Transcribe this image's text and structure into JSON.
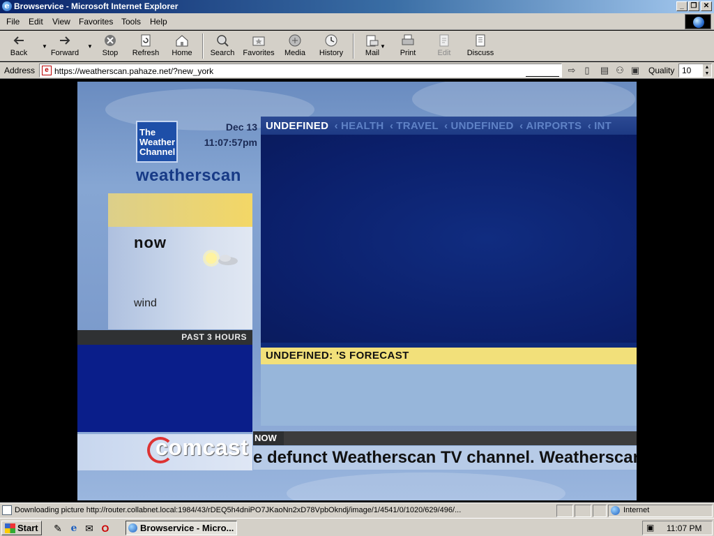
{
  "window": {
    "title": "Browservice - Microsoft Internet Explorer",
    "buttons": {
      "minimize": "_",
      "restore": "❐",
      "close": "✕"
    }
  },
  "menu": [
    "File",
    "Edit",
    "View",
    "Favorites",
    "Tools",
    "Help"
  ],
  "toolbar": {
    "back": "Back",
    "forward": "Forward",
    "stop": "Stop",
    "refresh": "Refresh",
    "home": "Home",
    "search": "Search",
    "favorites": "Favorites",
    "media": "Media",
    "history": "History",
    "mail": "Mail",
    "print": "Print",
    "edit": "Edit",
    "discuss": "Discuss"
  },
  "address": {
    "label": "Address",
    "url": "https://weatherscan.pahaze.net/?new_york",
    "quality_label": "Quality",
    "quality_value": "10"
  },
  "weatherscan": {
    "logo_text": "The Weather Channel",
    "date": "Dec 13",
    "time": "11:07:57pm",
    "brand": "weatherscan",
    "now_label": "now",
    "wind_label": "wind",
    "past_label": "PAST 3 HOURS",
    "nav_active": "UNDEFINED",
    "nav_items": [
      "HEALTH",
      "TRAVEL",
      "UNDEFINED",
      "AIRPORTS",
      "INT"
    ],
    "forecast_title": "UNDEFINED:  'S FORECAST",
    "sponsor": "comcast",
    "now_tag": "NOW",
    "ticker": "e defunct Weatherscan TV channel. Weatherscan"
  },
  "status": {
    "text": "Downloading picture http://router.collabnet.local:1984/43/rDEQ5h4dniPO7JKaoNn2xD78VpbOkndj/image/1/4541/0/1020/629/496/...",
    "zone": "Internet"
  },
  "taskbar": {
    "start": "Start",
    "task": "Browservice - Micro...",
    "clock": "11:07 PM"
  },
  "colors": {
    "titlebar": "#0a246a",
    "chrome": "#d4d0c8",
    "forecast_yellow": "#f2e07a",
    "map_blue": "#0f2a78"
  }
}
